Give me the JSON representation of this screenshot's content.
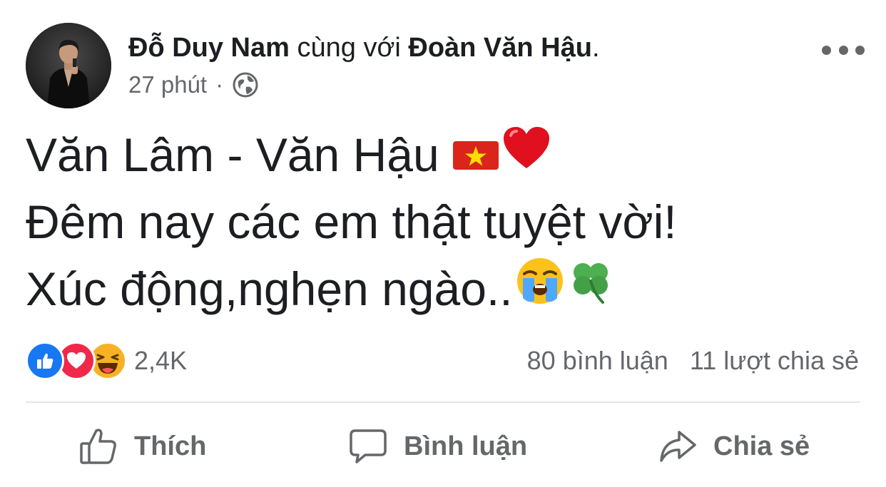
{
  "post": {
    "author": "Đỗ Duy Nam",
    "with_text": "cùng với",
    "tagged": "Đoàn Văn Hậu",
    "period": ".",
    "time": "27 phút",
    "separator": "·",
    "privacy_icon": "globe-icon",
    "more_icon": "more-options-icon",
    "lines": [
      {
        "text": "Văn Lâm - Văn Hậu",
        "emojis": [
          "vietnam-flag-icon",
          "red-heart-icon"
        ]
      },
      {
        "text": "Đêm nay các em thật tuyệt vời!",
        "emojis": []
      },
      {
        "text": "Xúc động,nghẹn ngào..",
        "emojis": [
          "crying-face-icon",
          "shamrock-icon"
        ]
      }
    ]
  },
  "reactions": {
    "icons": [
      "like-reaction-icon",
      "love-reaction-icon",
      "haha-reaction-icon"
    ],
    "count": "2,4K"
  },
  "stats": {
    "comments": "80 bình luận",
    "shares": "11 lượt chia sẻ"
  },
  "actions": {
    "like": "Thích",
    "comment": "Bình luận",
    "share": "Chia sẻ"
  },
  "colors": {
    "text": "#1c1e21",
    "muted": "#65676b",
    "divider": "#e4e6eb",
    "like_blue": "#1877f2",
    "love_red": "#f02849",
    "haha_yellow": "#f7b125"
  }
}
